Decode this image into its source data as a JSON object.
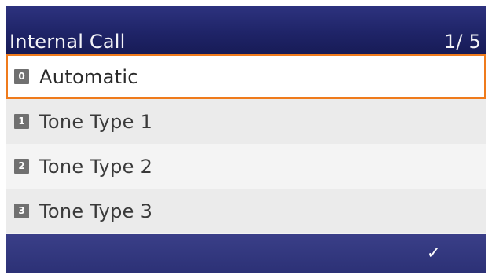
{
  "header": {
    "title": "Internal Call",
    "page_indicator": "1/ 5"
  },
  "list": {
    "items": [
      {
        "key": "0",
        "label": "Automatic",
        "selected": true
      },
      {
        "key": "1",
        "label": "Tone Type 1",
        "selected": false
      },
      {
        "key": "2",
        "label": "Tone Type 2",
        "selected": false
      },
      {
        "key": "3",
        "label": "Tone Type 3",
        "selected": false
      }
    ]
  },
  "footer": {
    "ok_glyph": "✓",
    "ok_icon": "checkmark-icon"
  },
  "colors": {
    "header_bg": "#1f2468",
    "footer_bg": "#2c3176",
    "selection_border": "#ef7b1c",
    "key_badge": "#707070"
  }
}
